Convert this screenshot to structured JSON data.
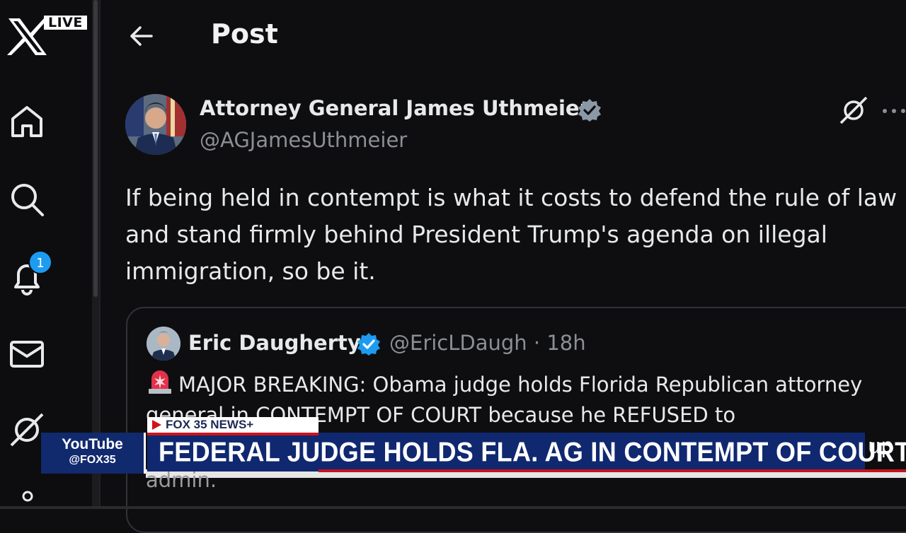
{
  "sidebar": {
    "live_badge": "LIVE",
    "notification_count": "1",
    "icons": [
      "x-logo-icon",
      "home-icon",
      "search-icon",
      "bell-icon",
      "mail-icon",
      "grok-icon",
      "user-icon"
    ]
  },
  "header": {
    "title": "Post"
  },
  "post": {
    "author_name": "Attorney General James Uthmeier",
    "author_handle": "@AGJamesUthmeier",
    "text": "If being held in contempt is what it costs to defend the rule of law and stand firmly behind President Trump's agenda on illegal immigration, so be it."
  },
  "quote": {
    "author_name": "Eric Daugherty",
    "meta": "@EricLDaugh · 18h",
    "text": "MAJOR BREAKING: Obama judge holds Florida Republican attorney general in CONTEMPT OF COURT because he REFUSED to"
  },
  "broadcast": {
    "youtube_label": "YouTube",
    "youtube_handle": "@FOX35",
    "network": "FOX 35 NEWS+",
    "headline": "FEDERAL JUDGE HOLDS FLA. AG IN CONTEMPT OF COURT",
    "tail_fragment": "up",
    "tail_fragment2": "admin."
  },
  "colors": {
    "background": "#0e0e10",
    "verified": "#1d9bf0",
    "headline_bg": "#102870",
    "accent_red": "#d0131a"
  }
}
